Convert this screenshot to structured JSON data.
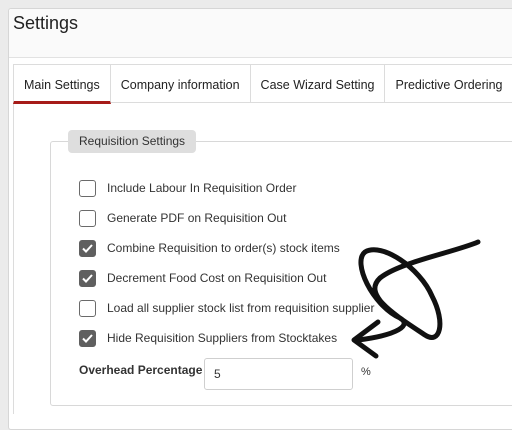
{
  "page_title": "Settings",
  "tabs": [
    {
      "label": "Main Settings",
      "active": true
    },
    {
      "label": "Company information",
      "active": false
    },
    {
      "label": "Case Wizard Setting",
      "active": false
    },
    {
      "label": "Predictive Ordering",
      "active": false
    }
  ],
  "section_title": "Requisition Settings",
  "options": [
    {
      "label": "Include Labour In Requisition Order",
      "checked": false
    },
    {
      "label": "Generate PDF on Requisition Out",
      "checked": false
    },
    {
      "label": "Combine Requisition to order(s) stock items",
      "checked": true
    },
    {
      "label": "Decrement Food Cost on Requisition Out",
      "checked": true
    },
    {
      "label": "Load all supplier stock list from requisition supplier",
      "checked": false
    },
    {
      "label": "Hide Requisition Suppliers from Stocktakes",
      "checked": true
    }
  ],
  "overhead": {
    "label": "Overhead Percentage",
    "value": "5",
    "unit": "%"
  },
  "colors": {
    "active_tab_underline": "#a61b18",
    "checkbox_checked": "#5f5f5f",
    "section_badge": "#dedede"
  }
}
